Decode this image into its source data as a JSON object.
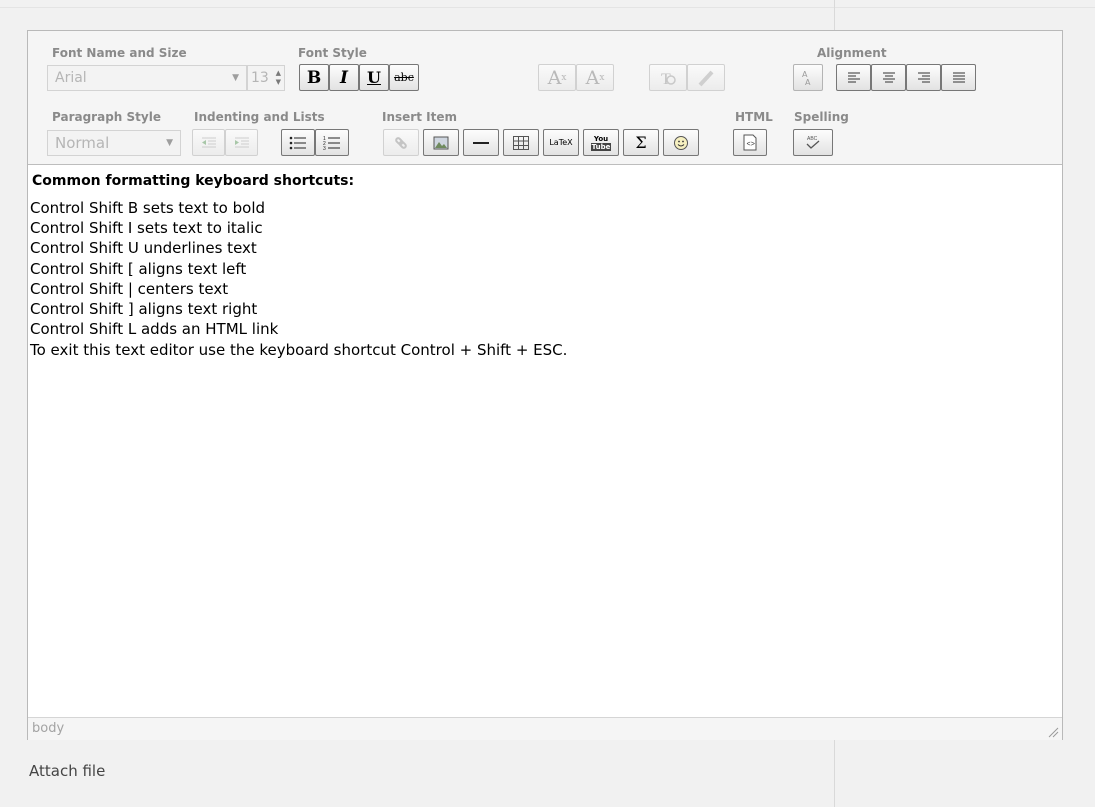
{
  "toolbar": {
    "groups": {
      "font_name_size": "Font Name and Size",
      "font_style": "Font Style",
      "alignment": "Alignment",
      "paragraph_style": "Paragraph Style",
      "indent_lists": "Indenting and Lists",
      "insert_item": "Insert Item",
      "html": "HTML",
      "spelling": "Spelling"
    },
    "font_name": "Arial",
    "font_size": "13",
    "paragraph_style": "Normal",
    "bold": "B",
    "italic": "I",
    "underline": "U",
    "strike": "abc",
    "subscript": "A",
    "subscript_mark": "x",
    "superscript": "A",
    "superscript_mark": "x",
    "latex": "LaTeX",
    "youtube_top": "You",
    "youtube_bottom": "Tube",
    "sigma": "Σ",
    "spell": "ABC"
  },
  "content": {
    "heading": "Common formatting keyboard shortcuts:",
    "lines": [
      "Control Shift B sets text to bold",
      "Control Shift I sets text to italic",
      "Control Shift U underlines text",
      "Control Shift [ aligns text left",
      "Control Shift | centers text",
      "Control Shift ] aligns text right",
      "Control Shift L adds an HTML link",
      "To exit this text editor use the keyboard shortcut Control + Shift + ESC."
    ]
  },
  "statusbar": {
    "path": "body"
  },
  "attach_label": "Attach file"
}
